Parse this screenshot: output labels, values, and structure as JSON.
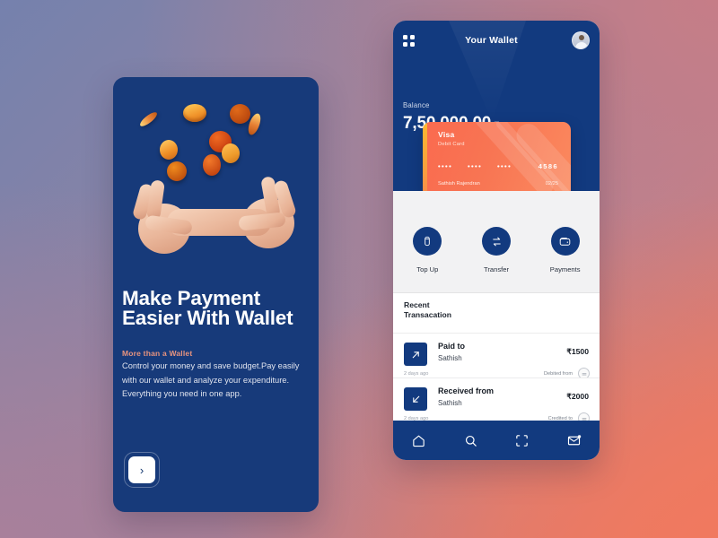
{
  "background": {
    "gradient_colors": [
      "#7581ad",
      "#c67d87",
      "#ef7a61",
      "#a8809b"
    ]
  },
  "onboarding": {
    "eyebrow": "More than a Wallet",
    "headline": "Make Payment Easier With Wallet",
    "paragraph": "Control your money and save budget.Pay easily with our wallet and analyze your expenditure. Everything you need in one app.",
    "next_icon": "›",
    "card_color": "#173a7a",
    "illustration": {
      "name": "hands-holding-coins-3d",
      "coin_count": 9
    }
  },
  "phone": {
    "header": {
      "menu_icon": "grid-icon",
      "title": "Your Wallet",
      "avatar": "user-avatar",
      "balance_label": "Balance",
      "balance_amount": "7,50,000.00",
      "currency": "₹",
      "color": "#123a7f"
    },
    "card": {
      "brand": "Visa",
      "type": "Debit Card",
      "mask": "••••",
      "last4": "4586",
      "holder": "Sathish Rajendran",
      "expiry": "02/25",
      "color": "#fa6a4f"
    },
    "actions": [
      {
        "label": "Top Up",
        "icon": "battery-icon"
      },
      {
        "label": "Transfer",
        "icon": "transfer-arrows-icon"
      },
      {
        "label": "Payments",
        "icon": "wallet-icon"
      }
    ],
    "recent": {
      "title_line1": "Recent",
      "title_line2": "Transacation"
    },
    "transactions": [
      {
        "icon": "arrow-up-right-icon",
        "title": "Paid to",
        "name": "Sathish",
        "amount": "₹1500",
        "time": "2 days ago",
        "direction": "Debited from",
        "badge": "bank-icon"
      },
      {
        "icon": "arrow-down-left-icon",
        "title": "Received from",
        "name": "Sathish",
        "amount": "₹2000",
        "time": "2 days ago",
        "direction": "Credited to",
        "badge": "bank-icon"
      }
    ],
    "navbar": [
      {
        "icon": "home-icon",
        "active": true
      },
      {
        "icon": "search-icon",
        "active": false
      },
      {
        "icon": "scan-icon",
        "active": false
      },
      {
        "icon": "mail-icon",
        "active": false
      }
    ]
  }
}
